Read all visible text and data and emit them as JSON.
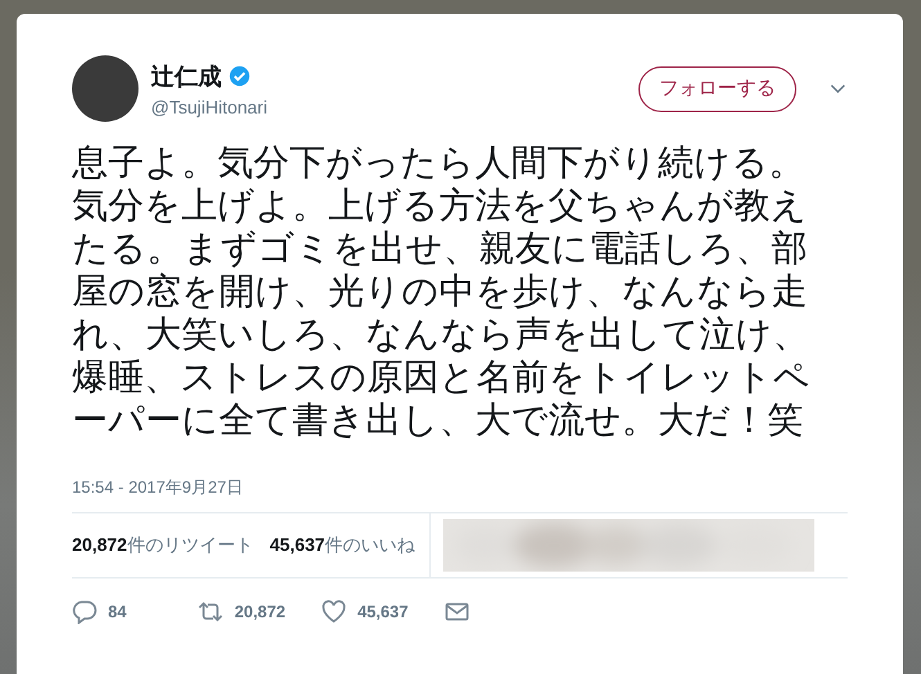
{
  "author": {
    "name": "辻仁成",
    "verified": true,
    "handle": "@TsujiHitonari"
  },
  "follow_button": "フォローする",
  "tweet_lines": [
    "息子よ。気分下がったら人間下がり続ける。",
    "気分を上げよ。上げる方法を父ちゃんが教え",
    "たる。まずゴミを出せ、親友に電話しろ、部",
    "屋の窓を開け、光りの中を歩け、なんなら走",
    "れ、大笑いしろ、なんなら声を出して泣け、",
    "爆睡、ストレスの原因と名前をトイレットペ",
    "ーパーに全て書き出し、大で流せ。大だ！笑"
  ],
  "timestamp": "15:54 - 2017年9月27日",
  "stats": [
    {
      "count": "20,872",
      "label": "件のリツイート"
    },
    {
      "count": "45,637",
      "label": "件のいいね"
    }
  ],
  "actions": [
    {
      "kind": "reply",
      "count": "84"
    },
    {
      "kind": "retweet",
      "count": "20,872"
    },
    {
      "kind": "like",
      "count": "45,637"
    },
    {
      "kind": "message"
    }
  ]
}
